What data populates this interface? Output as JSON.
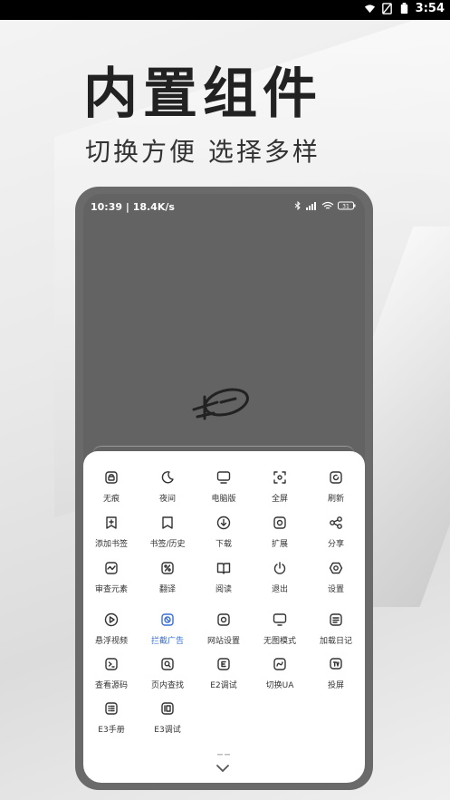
{
  "status_bar": {
    "time": "3:54",
    "icons": [
      "wifi-icon",
      "sim-icon",
      "battery-icon"
    ]
  },
  "headline": "内置组件",
  "subline": "切换方便 选择多样",
  "phone": {
    "status": {
      "time_speed": "10:39 | 18.4K/s",
      "battery_level": "31",
      "icons": [
        "bluetooth-icon",
        "signal-icon",
        "wifi-icon",
        "battery-icon"
      ]
    },
    "menu": [
      {
        "label": "无痕",
        "icon": "incognito-icon"
      },
      {
        "label": "夜间",
        "icon": "moon-icon"
      },
      {
        "label": "电脑版",
        "icon": "desktop-icon"
      },
      {
        "label": "全屏",
        "icon": "fullscreen-icon"
      },
      {
        "label": "刷新",
        "icon": "refresh-icon"
      },
      {
        "label": "添加书签",
        "icon": "add-bookmark-icon"
      },
      {
        "label": "书签/历史",
        "icon": "bookmark-icon"
      },
      {
        "label": "下载",
        "icon": "download-icon"
      },
      {
        "label": "扩展",
        "icon": "extension-icon"
      },
      {
        "label": "分享",
        "icon": "share-icon"
      },
      {
        "label": "审查元素",
        "icon": "inspect-icon"
      },
      {
        "label": "翻译",
        "icon": "translate-icon"
      },
      {
        "label": "阅读",
        "icon": "book-icon"
      },
      {
        "label": "退出",
        "icon": "power-icon"
      },
      {
        "label": "设置",
        "icon": "settings-icon"
      },
      {
        "label": "悬浮视频",
        "icon": "play-icon"
      },
      {
        "label": "拦截广告",
        "icon": "block-ads-icon",
        "active": true
      },
      {
        "label": "网站设置",
        "icon": "site-settings-icon"
      },
      {
        "label": "无图模式",
        "icon": "no-image-icon"
      },
      {
        "label": "加载日记",
        "icon": "log-icon"
      },
      {
        "label": "查看源码",
        "icon": "source-code-icon"
      },
      {
        "label": "页内查找",
        "icon": "find-icon"
      },
      {
        "label": "E2调试",
        "icon": "debug-icon"
      },
      {
        "label": "切换UA",
        "icon": "switch-ua-icon"
      },
      {
        "label": "投屏",
        "icon": "cast-icon"
      },
      {
        "label": "E3手册",
        "icon": "manual-icon"
      },
      {
        "label": "E3调试",
        "icon": "e3-debug-icon"
      }
    ],
    "accent_color": "#3a6fd0"
  }
}
